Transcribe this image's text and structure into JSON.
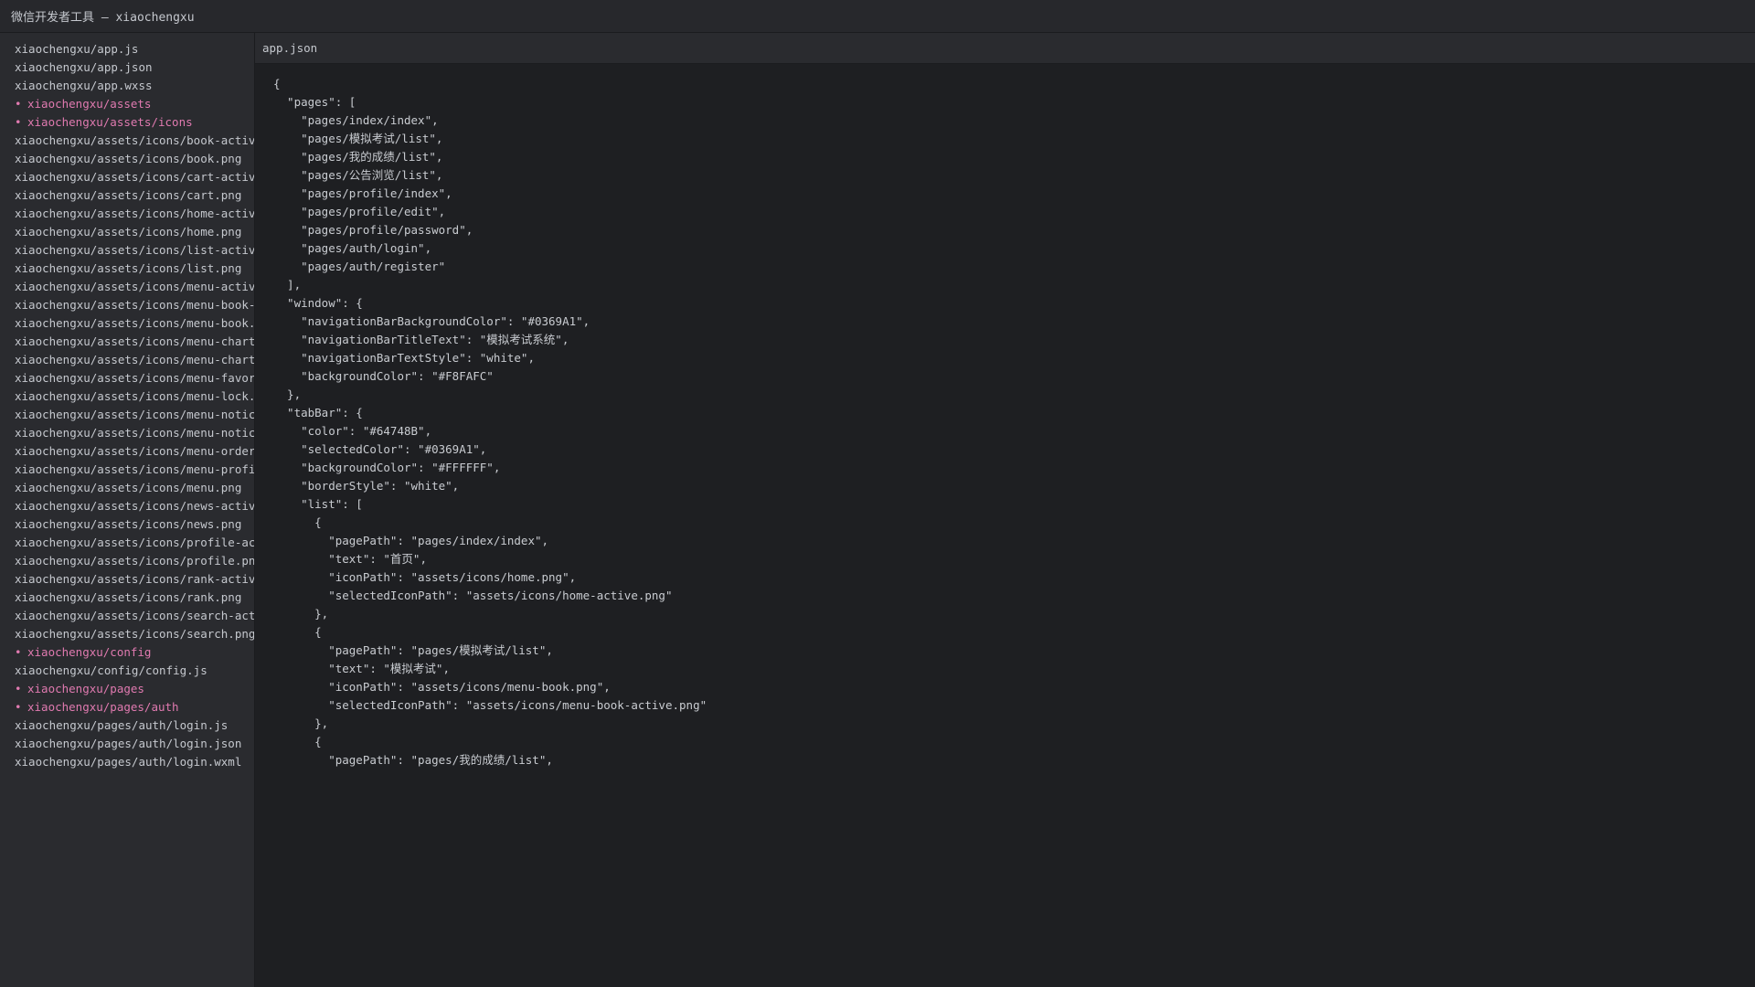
{
  "window": {
    "title": "微信开发者工具 — xiaochengxu"
  },
  "sidebar": {
    "items": [
      {
        "label": "xiaochengxu/app.js",
        "folder": false
      },
      {
        "label": "xiaochengxu/app.json",
        "folder": false
      },
      {
        "label": "xiaochengxu/app.wxss",
        "folder": false
      },
      {
        "label": "xiaochengxu/assets",
        "folder": true
      },
      {
        "label": "xiaochengxu/assets/icons",
        "folder": true
      },
      {
        "label": "xiaochengxu/assets/icons/book-active.",
        "folder": false
      },
      {
        "label": "xiaochengxu/assets/icons/book.png",
        "folder": false
      },
      {
        "label": "xiaochengxu/assets/icons/cart-active.",
        "folder": false
      },
      {
        "label": "xiaochengxu/assets/icons/cart.png",
        "folder": false
      },
      {
        "label": "xiaochengxu/assets/icons/home-active.",
        "folder": false
      },
      {
        "label": "xiaochengxu/assets/icons/home.png",
        "folder": false
      },
      {
        "label": "xiaochengxu/assets/icons/list-active.",
        "folder": false
      },
      {
        "label": "xiaochengxu/assets/icons/list.png",
        "folder": false
      },
      {
        "label": "xiaochengxu/assets/icons/menu-active.",
        "folder": false
      },
      {
        "label": "xiaochengxu/assets/icons/menu-book-ac",
        "folder": false
      },
      {
        "label": "xiaochengxu/assets/icons/menu-book.pr",
        "folder": false
      },
      {
        "label": "xiaochengxu/assets/icons/menu-chart-a",
        "folder": false
      },
      {
        "label": "xiaochengxu/assets/icons/menu-chart.p",
        "folder": false
      },
      {
        "label": "xiaochengxu/assets/icons/menu-favorit",
        "folder": false
      },
      {
        "label": "xiaochengxu/assets/icons/menu-lock.pr",
        "folder": false
      },
      {
        "label": "xiaochengxu/assets/icons/menu-notice-",
        "folder": false
      },
      {
        "label": "xiaochengxu/assets/icons/menu-notice.",
        "folder": false
      },
      {
        "label": "xiaochengxu/assets/icons/menu-order.p",
        "folder": false
      },
      {
        "label": "xiaochengxu/assets/icons/menu-profile",
        "folder": false
      },
      {
        "label": "xiaochengxu/assets/icons/menu.png",
        "folder": false
      },
      {
        "label": "xiaochengxu/assets/icons/news-active.",
        "folder": false
      },
      {
        "label": "xiaochengxu/assets/icons/news.png",
        "folder": false
      },
      {
        "label": "xiaochengxu/assets/icons/profile-acti",
        "folder": false
      },
      {
        "label": "xiaochengxu/assets/icons/profile.png",
        "folder": false
      },
      {
        "label": "xiaochengxu/assets/icons/rank-active.",
        "folder": false
      },
      {
        "label": "xiaochengxu/assets/icons/rank.png",
        "folder": false
      },
      {
        "label": "xiaochengxu/assets/icons/search-activ",
        "folder": false
      },
      {
        "label": "xiaochengxu/assets/icons/search.png",
        "folder": false
      },
      {
        "label": "xiaochengxu/config",
        "folder": true
      },
      {
        "label": "xiaochengxu/config/config.js",
        "folder": false
      },
      {
        "label": "xiaochengxu/pages",
        "folder": true
      },
      {
        "label": "xiaochengxu/pages/auth",
        "folder": true
      },
      {
        "label": "xiaochengxu/pages/auth/login.js",
        "folder": false
      },
      {
        "label": "xiaochengxu/pages/auth/login.json",
        "folder": false
      },
      {
        "label": "xiaochengxu/pages/auth/login.wxml",
        "folder": false
      }
    ]
  },
  "editor": {
    "tab_label": "app.json",
    "lines": [
      "{",
      "  \"pages\": [",
      "    \"pages/index/index\",",
      "    \"pages/模拟考试/list\",",
      "    \"pages/我的成绩/list\",",
      "    \"pages/公告浏览/list\",",
      "    \"pages/profile/index\",",
      "    \"pages/profile/edit\",",
      "    \"pages/profile/password\",",
      "    \"pages/auth/login\",",
      "    \"pages/auth/register\"",
      "  ],",
      "  \"window\": {",
      "    \"navigationBarBackgroundColor\": \"#0369A1\",",
      "    \"navigationBarTitleText\": \"模拟考试系统\",",
      "    \"navigationBarTextStyle\": \"white\",",
      "    \"backgroundColor\": \"#F8FAFC\"",
      "  },",
      "  \"tabBar\": {",
      "    \"color\": \"#64748B\",",
      "    \"selectedColor\": \"#0369A1\",",
      "    \"backgroundColor\": \"#FFFFFF\",",
      "    \"borderStyle\": \"white\",",
      "    \"list\": [",
      "      {",
      "        \"pagePath\": \"pages/index/index\",",
      "        \"text\": \"首页\",",
      "        \"iconPath\": \"assets/icons/home.png\",",
      "        \"selectedIconPath\": \"assets/icons/home-active.png\"",
      "      },",
      "      {",
      "        \"pagePath\": \"pages/模拟考试/list\",",
      "        \"text\": \"模拟考试\",",
      "        \"iconPath\": \"assets/icons/menu-book.png\",",
      "        \"selectedIconPath\": \"assets/icons/menu-book-active.png\"",
      "      },",
      "      {",
      "        \"pagePath\": \"pages/我的成绩/list\","
    ]
  },
  "colors": {
    "folder_accent": "#e07ab0",
    "background": "#1e1f22",
    "sidebar_background": "#2a2b2f"
  }
}
